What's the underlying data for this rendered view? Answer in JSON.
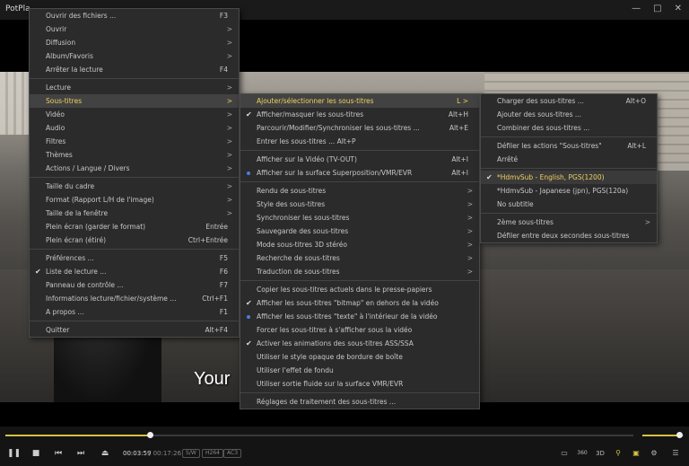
{
  "app": {
    "title": "PotPla"
  },
  "window": {
    "controls": [
      "—",
      "□",
      "✕"
    ]
  },
  "video": {
    "subtitle_text": "Your"
  },
  "menu1": {
    "items": [
      {
        "label": "Ouvrir des fichiers ...",
        "shortcut": "F3"
      },
      {
        "label": "Ouvrir",
        "arrow": ">"
      },
      {
        "label": "Diffusion",
        "arrow": ">"
      },
      {
        "label": "Album/Favoris",
        "arrow": ">"
      },
      {
        "label": "Arrêter la lecture",
        "shortcut": "F4"
      },
      {
        "label": "Lecture",
        "arrow": ">"
      },
      {
        "label": "Sous-titres",
        "arrow": ">"
      },
      {
        "label": "Vidéo",
        "arrow": ">"
      },
      {
        "label": "Audio",
        "arrow": ">"
      },
      {
        "label": "Filtres",
        "arrow": ">"
      },
      {
        "label": "Thèmes",
        "arrow": ">"
      },
      {
        "label": "Actions / Langue / Divers",
        "arrow": ">"
      },
      {
        "label": "Taille du cadre",
        "arrow": ">"
      },
      {
        "label": "Format (Rapport L/H de l'image)",
        "arrow": ">"
      },
      {
        "label": "Taille de la fenêtre",
        "arrow": ">"
      },
      {
        "label": "Plein écran (garder le format)",
        "shortcut": "Entrée"
      },
      {
        "label": "Plein écran (étiré)",
        "shortcut": "Ctrl+Entrée"
      },
      {
        "label": "Préférences ...",
        "shortcut": "F5"
      },
      {
        "label": "Liste de lecture ...",
        "shortcut": "F6",
        "mark": "✔"
      },
      {
        "label": "Panneau de contrôle ...",
        "shortcut": "F7"
      },
      {
        "label": "Informations lecture/fichier/système ...",
        "shortcut": "Ctrl+F1"
      },
      {
        "label": "A propos ...",
        "shortcut": "F1"
      },
      {
        "label": "Quitter",
        "shortcut": "Alt+F4"
      }
    ]
  },
  "menu2": {
    "items": [
      {
        "label": "Ajouter/sélectionner les sous-titres",
        "shortcut": "L >"
      },
      {
        "label": "Afficher/masquer les sous-titres",
        "shortcut": "Alt+H",
        "mark": "✔"
      },
      {
        "label": "Parcourir/Modifier/Synchroniser les sous-titres ...",
        "shortcut": "Alt+E"
      },
      {
        "label": "Entrer les sous-titres ... Alt+P"
      },
      {
        "label": "Afficher sur la Vidéo (TV-OUT)",
        "shortcut": "Alt+I"
      },
      {
        "label": "Afficher sur la surface Superposition/VMR/EVR",
        "shortcut": "Alt+I",
        "dot": true
      },
      {
        "label": "Rendu de sous-titres",
        "arrow": ">"
      },
      {
        "label": "Style des sous-titres",
        "arrow": ">"
      },
      {
        "label": "Synchroniser les sous-titres",
        "arrow": ">"
      },
      {
        "label": "Sauvegarde des sous-titres",
        "arrow": ">"
      },
      {
        "label": "Mode sous-titres 3D stéréo",
        "arrow": ">"
      },
      {
        "label": "Recherche de sous-titres",
        "arrow": ">"
      },
      {
        "label": "Traduction de sous-titres",
        "arrow": ">"
      },
      {
        "label": "Copier les sous-titres actuels dans le presse-papiers"
      },
      {
        "label": "Afficher les sous-titres \"bitmap\" en dehors de la vidéo",
        "mark": "✔"
      },
      {
        "label": "Afficher les sous-titres \"texte\" à l'intérieur de la vidéo",
        "dot": true
      },
      {
        "label": "Forcer les sous-titres à s'afficher sous la vidéo"
      },
      {
        "label": "Activer les animations des sous-titres ASS/SSA",
        "mark": "✔"
      },
      {
        "label": "Utiliser le style opaque de bordure de boîte"
      },
      {
        "label": "Utiliser l'effet de fondu"
      },
      {
        "label": "Utiliser sortie fluide sur la surface VMR/EVR"
      },
      {
        "label": "Réglages de traitement des sous-titres ..."
      }
    ]
  },
  "menu3": {
    "items": [
      {
        "label": "Charger des sous-titres ...",
        "shortcut": "Alt+O"
      },
      {
        "label": "Ajouter des sous-titres ..."
      },
      {
        "label": "Combiner des sous-titres ..."
      },
      {
        "label": "Défiler les actions \"Sous-titres\"",
        "shortcut": "Alt+L"
      },
      {
        "label": "Arrêté"
      },
      {
        "label": "*HdmvSub - English, PGS(1200)",
        "mark": "✔"
      },
      {
        "label": "*HdmvSub - Japanese (jpn), PGS(120a)"
      },
      {
        "label": "No subtitle"
      },
      {
        "label": "2ème sous-titres",
        "arrow": ">"
      },
      {
        "label": "Défiler entre deux secondes sous-titres"
      }
    ]
  },
  "controls": {
    "progress_percent": 23,
    "volume_percent": 90,
    "time_current": "00:03:59",
    "time_total": "/ 00:17:26",
    "tags": [
      "S/W",
      "H264",
      "AC3"
    ],
    "right_buttons": [
      "360",
      "3D"
    ]
  },
  "colors": {
    "accent": "#f0d060",
    "seek": "#d4c240",
    "radio": "#4a7ee0"
  }
}
